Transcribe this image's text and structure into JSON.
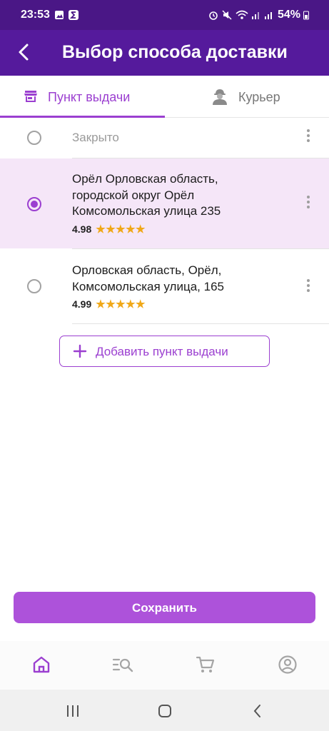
{
  "status_bar": {
    "time": "23:53",
    "battery": "54%"
  },
  "header": {
    "title": "Выбор способа доставки"
  },
  "tabs": [
    {
      "label": "Пункт выдачи",
      "icon": "store-icon",
      "active": true
    },
    {
      "label": "Курьер",
      "icon": "courier-icon",
      "active": false
    }
  ],
  "pickup_points": [
    {
      "address_lines": [
        "Закрыто"
      ],
      "rating": "",
      "selected": false,
      "closed": true
    },
    {
      "address_lines": [
        "Орёл Орловская область,",
        "городской округ Орёл",
        "Комсомольская улица 235"
      ],
      "rating": "4.98",
      "stars": "★★★★★",
      "selected": true
    },
    {
      "address_lines": [
        "Орловская область, Орёл,",
        "Комсомольская улица, 165"
      ],
      "rating": "4.99",
      "stars": "★★★★★",
      "selected": false
    }
  ],
  "add_button": {
    "label": "Добавить пункт выдачи"
  },
  "save_button": {
    "label": "Сохранить"
  },
  "bottom_nav": [
    "home-icon",
    "catalog-search-icon",
    "cart-icon",
    "profile-icon"
  ],
  "colors": {
    "accent": "#9b3fd0",
    "header": "#551a9c",
    "status_bar": "#4a1786",
    "save_button": "#ad52da",
    "star": "#f0a818",
    "selected_row": "#f5e6f8"
  }
}
